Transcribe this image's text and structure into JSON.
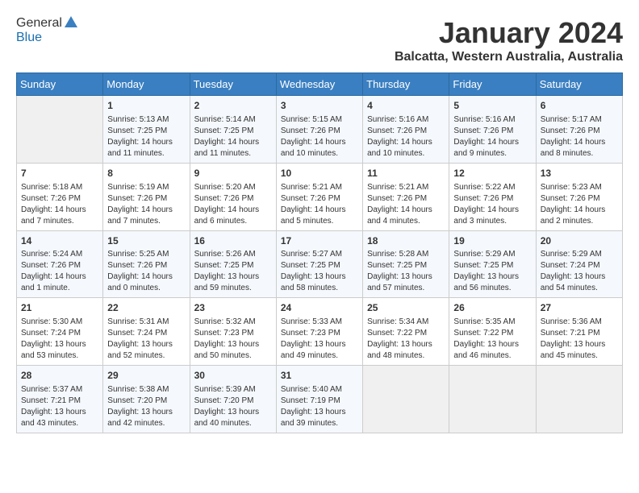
{
  "header": {
    "logo_line1": "General",
    "logo_line2": "Blue",
    "month_year": "January 2024",
    "location": "Balcatta, Western Australia, Australia"
  },
  "calendar": {
    "days_of_week": [
      "Sunday",
      "Monday",
      "Tuesday",
      "Wednesday",
      "Thursday",
      "Friday",
      "Saturday"
    ],
    "weeks": [
      [
        {
          "day": "",
          "info": ""
        },
        {
          "day": "1",
          "info": "Sunrise: 5:13 AM\nSunset: 7:25 PM\nDaylight: 14 hours\nand 11 minutes."
        },
        {
          "day": "2",
          "info": "Sunrise: 5:14 AM\nSunset: 7:25 PM\nDaylight: 14 hours\nand 11 minutes."
        },
        {
          "day": "3",
          "info": "Sunrise: 5:15 AM\nSunset: 7:26 PM\nDaylight: 14 hours\nand 10 minutes."
        },
        {
          "day": "4",
          "info": "Sunrise: 5:16 AM\nSunset: 7:26 PM\nDaylight: 14 hours\nand 10 minutes."
        },
        {
          "day": "5",
          "info": "Sunrise: 5:16 AM\nSunset: 7:26 PM\nDaylight: 14 hours\nand 9 minutes."
        },
        {
          "day": "6",
          "info": "Sunrise: 5:17 AM\nSunset: 7:26 PM\nDaylight: 14 hours\nand 8 minutes."
        }
      ],
      [
        {
          "day": "7",
          "info": "Sunrise: 5:18 AM\nSunset: 7:26 PM\nDaylight: 14 hours\nand 7 minutes."
        },
        {
          "day": "8",
          "info": "Sunrise: 5:19 AM\nSunset: 7:26 PM\nDaylight: 14 hours\nand 7 minutes."
        },
        {
          "day": "9",
          "info": "Sunrise: 5:20 AM\nSunset: 7:26 PM\nDaylight: 14 hours\nand 6 minutes."
        },
        {
          "day": "10",
          "info": "Sunrise: 5:21 AM\nSunset: 7:26 PM\nDaylight: 14 hours\nand 5 minutes."
        },
        {
          "day": "11",
          "info": "Sunrise: 5:21 AM\nSunset: 7:26 PM\nDaylight: 14 hours\nand 4 minutes."
        },
        {
          "day": "12",
          "info": "Sunrise: 5:22 AM\nSunset: 7:26 PM\nDaylight: 14 hours\nand 3 minutes."
        },
        {
          "day": "13",
          "info": "Sunrise: 5:23 AM\nSunset: 7:26 PM\nDaylight: 14 hours\nand 2 minutes."
        }
      ],
      [
        {
          "day": "14",
          "info": "Sunrise: 5:24 AM\nSunset: 7:26 PM\nDaylight: 14 hours\nand 1 minute."
        },
        {
          "day": "15",
          "info": "Sunrise: 5:25 AM\nSunset: 7:26 PM\nDaylight: 14 hours\nand 0 minutes."
        },
        {
          "day": "16",
          "info": "Sunrise: 5:26 AM\nSunset: 7:25 PM\nDaylight: 13 hours\nand 59 minutes."
        },
        {
          "day": "17",
          "info": "Sunrise: 5:27 AM\nSunset: 7:25 PM\nDaylight: 13 hours\nand 58 minutes."
        },
        {
          "day": "18",
          "info": "Sunrise: 5:28 AM\nSunset: 7:25 PM\nDaylight: 13 hours\nand 57 minutes."
        },
        {
          "day": "19",
          "info": "Sunrise: 5:29 AM\nSunset: 7:25 PM\nDaylight: 13 hours\nand 56 minutes."
        },
        {
          "day": "20",
          "info": "Sunrise: 5:29 AM\nSunset: 7:24 PM\nDaylight: 13 hours\nand 54 minutes."
        }
      ],
      [
        {
          "day": "21",
          "info": "Sunrise: 5:30 AM\nSunset: 7:24 PM\nDaylight: 13 hours\nand 53 minutes."
        },
        {
          "day": "22",
          "info": "Sunrise: 5:31 AM\nSunset: 7:24 PM\nDaylight: 13 hours\nand 52 minutes."
        },
        {
          "day": "23",
          "info": "Sunrise: 5:32 AM\nSunset: 7:23 PM\nDaylight: 13 hours\nand 50 minutes."
        },
        {
          "day": "24",
          "info": "Sunrise: 5:33 AM\nSunset: 7:23 PM\nDaylight: 13 hours\nand 49 minutes."
        },
        {
          "day": "25",
          "info": "Sunrise: 5:34 AM\nSunset: 7:22 PM\nDaylight: 13 hours\nand 48 minutes."
        },
        {
          "day": "26",
          "info": "Sunrise: 5:35 AM\nSunset: 7:22 PM\nDaylight: 13 hours\nand 46 minutes."
        },
        {
          "day": "27",
          "info": "Sunrise: 5:36 AM\nSunset: 7:21 PM\nDaylight: 13 hours\nand 45 minutes."
        }
      ],
      [
        {
          "day": "28",
          "info": "Sunrise: 5:37 AM\nSunset: 7:21 PM\nDaylight: 13 hours\nand 43 minutes."
        },
        {
          "day": "29",
          "info": "Sunrise: 5:38 AM\nSunset: 7:20 PM\nDaylight: 13 hours\nand 42 minutes."
        },
        {
          "day": "30",
          "info": "Sunrise: 5:39 AM\nSunset: 7:20 PM\nDaylight: 13 hours\nand 40 minutes."
        },
        {
          "day": "31",
          "info": "Sunrise: 5:40 AM\nSunset: 7:19 PM\nDaylight: 13 hours\nand 39 minutes."
        },
        {
          "day": "",
          "info": ""
        },
        {
          "day": "",
          "info": ""
        },
        {
          "day": "",
          "info": ""
        }
      ]
    ]
  }
}
